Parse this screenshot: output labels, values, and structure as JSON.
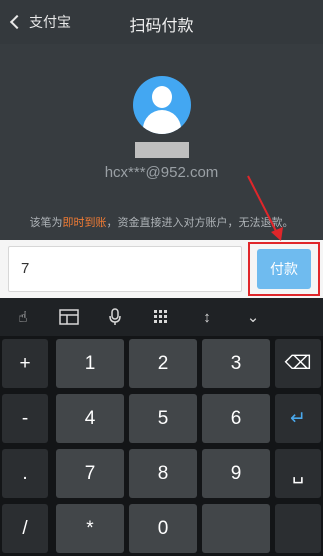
{
  "header": {
    "back_label": "支付宝",
    "title": "扫码付款"
  },
  "payee": {
    "account": "hcx***@952.com",
    "notice_prefix": "该笔为",
    "notice_highlight": "即时到账",
    "notice_suffix": "，资金直接进入对方账户，无法退款。"
  },
  "input": {
    "amount_value": "7",
    "pay_label": "付款"
  },
  "keyboard": {
    "toolbar": [
      "gesture-icon",
      "layout-icon",
      "mic-icon",
      "numpad-icon",
      "cursor-move-icon",
      "collapse-icon"
    ],
    "rows": [
      [
        "+",
        "1",
        "2",
        "3",
        "⌫"
      ],
      [
        "-",
        "4",
        "5",
        "6",
        "↵"
      ],
      [
        ".",
        "7",
        "8",
        "9",
        "␣"
      ],
      [
        "/",
        "*",
        "0",
        "",
        ""
      ]
    ]
  },
  "colors": {
    "accent": "#43a7f2",
    "highlight": "#f07b34",
    "annotation": "#e0262a",
    "pay_button": "#6fbbef"
  }
}
